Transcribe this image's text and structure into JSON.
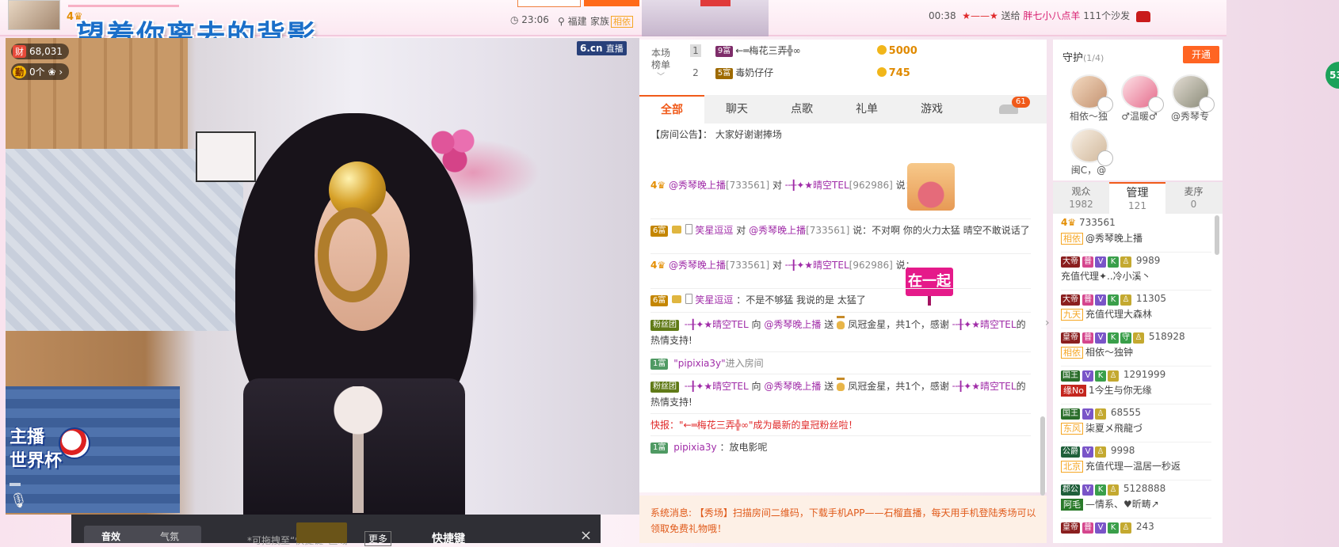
{
  "top": {
    "title": "望着你离去的背影",
    "time": "23:06",
    "location": "福建",
    "family_label": "家族",
    "family_badge": "相依",
    "gift_log": {
      "time": "00:38",
      "from": "★——★",
      "action": "送给",
      "to": "胖七小八点羊",
      "count": "111个沙发"
    }
  },
  "video": {
    "wealth_tag": "财",
    "wealth_value": "68,031",
    "diligence_tag": "勤",
    "diligence_value": "0个",
    "site": "6.cn",
    "site_sub": "直播",
    "event_line1": "主播",
    "event_line2": "世界杯"
  },
  "toolbar": {
    "tab_sound": "音效",
    "tab_atmos": "气氛",
    "hint": "*可拖拽至“快捷键”区域",
    "more": "更多",
    "title": "快捷键",
    "close": "×"
  },
  "rank": {
    "label_line1": "本场",
    "label_line2": "榜单",
    "rows": [
      {
        "no": "1",
        "level": "9富",
        "name": "←═梅花三弄╬∞",
        "amount": "5000"
      },
      {
        "no": "2",
        "level": "5富",
        "name": "毒奶仔仔",
        "amount": "745"
      }
    ]
  },
  "chat_tabs": [
    "全部",
    "聊天",
    "点歌",
    "礼单",
    "游戏"
  ],
  "car_count": "61",
  "chat": {
    "notice_label": "【房间公告】：",
    "notice": "大家好谢谢捧场",
    "m1_host": "@秀琴晚上播",
    "m1_host_id": "[733561]",
    "m1_to_word": "对",
    "m1_target": "╌╂✦★晴空TEL",
    "m1_target_id": "[962986]",
    "m1_says": "说：",
    "m2_level": "6富",
    "m2_user": "笑星逗逗",
    "m2_to_word": "对",
    "m2_target": "@秀琴晚上播",
    "m2_target_id": "[733561]",
    "m2_text": "说：不对啊 你的火力太猛 晴空不敢说话了",
    "m3_host": "@秀琴晚上播",
    "m3_host_id": "[733561]",
    "m3_to_word": "对",
    "m3_target": "╌╂✦★晴空TEL",
    "m3_target_id": "[962986]",
    "m3_says": "说：",
    "m3_sticker": "在一起",
    "m4_level": "6富",
    "m4_user": "笑星逗逗",
    "m4_text": "：不是不够猛 我说的是 太猛了",
    "m5_fan": "粉丝团",
    "m5_user": "╌╂✦★晴空TEL",
    "m5_to": "向",
    "m5_host": "@秀琴晚上播",
    "m5_send": "送",
    "m5_gift": "凤冠金星，共1个，感谢",
    "m5_user2": "╌╂✦★晴空TEL",
    "m5_tail": "的热情支持!",
    "m6_level": "1富",
    "m6_user": "\"pipixia3y\"",
    "m6_text": "进入房间",
    "m7_fan": "粉丝团",
    "m7_user": "╌╂✦★晴空TEL",
    "m7_to": "向",
    "m7_host": "@秀琴晚上播",
    "m7_send": "送",
    "m7_gift": "凤冠金星，共1个，感谢",
    "m7_user2": "╌╂✦★晴空TEL",
    "m7_tail": "的热情支持!",
    "m8_text": "快报：\"←═梅花三弄╬∞\"成为最新的皇冠粉丝啦！",
    "m9_level": "1富",
    "m9_user": "pipixia3y",
    "m9_text": "：放电影呢"
  },
  "system_msg": "系统消息: 【秀场】扫描房间二维码，下载手机APP——石榴直播，每天用手机登陆秀场可以领取免费礼物哦！",
  "guard": {
    "title": "守护",
    "count": "(1/4)",
    "open_button": "开通",
    "members": [
      "相依～独",
      "♂温暖♂",
      "@秀琴专",
      "闽C，@"
    ]
  },
  "audience_tabs": [
    {
      "label": "观众",
      "count": "1982"
    },
    {
      "label": "管理",
      "count": "121"
    },
    {
      "label": "麦序",
      "count": "0"
    }
  ],
  "audience": [
    {
      "id": "733561",
      "fam": "相依",
      "name": "@秀琴晚上播"
    },
    {
      "rank": "大帝",
      "id": "9989",
      "name": "充值代理✦..冷小溪丶"
    },
    {
      "rank": "大帝",
      "id": "11305",
      "fam": "九天",
      "name": "充值代理大森林"
    },
    {
      "rank": "皇帝",
      "id": "518928",
      "fam": "相依",
      "name": "相依～独钟"
    },
    {
      "rank": "国王",
      "id": "1291999",
      "fam": "缘No",
      "name": "1今生与你无缘"
    },
    {
      "rank": "国王",
      "id": "68555",
      "fam": "东风",
      "name": "柒夏メ飛龍づ"
    },
    {
      "rank": "公爵",
      "id": "9998",
      "fam": "北京",
      "name": "充值代理—温居一秒返"
    },
    {
      "rank": "郡公",
      "id": "5128888",
      "fam": "阿毛",
      "name": "—情系、♥昕畴↗"
    },
    {
      "rank": "皇帝",
      "id": "243",
      "name": ""
    }
  ],
  "side_float": "53"
}
